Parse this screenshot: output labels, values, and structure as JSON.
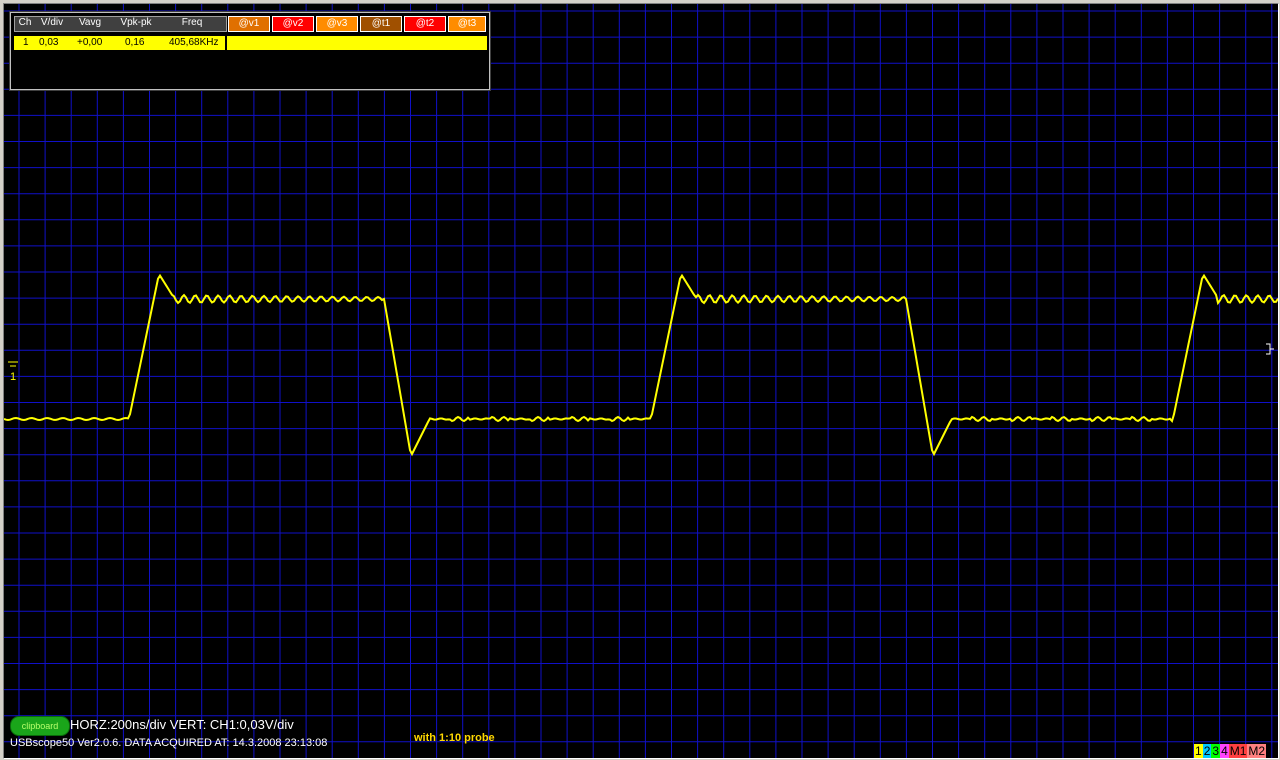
{
  "measure_table": {
    "headers": [
      "Ch",
      "V/div",
      "Vavg",
      "Vpk-pk",
      "Freq"
    ],
    "cursor_headers": [
      "@v1",
      "@v2",
      "@v3",
      "@t1",
      "@t2",
      "@t3"
    ],
    "row": {
      "ch": "1",
      "vdiv": "0,03",
      "vavg": "+0,00",
      "vpkpk": "0,16",
      "freq": "405,68KHz"
    }
  },
  "status": {
    "clipboard_label": "clipboard",
    "scale_line": "HORZ:200ns/div VERT: CH1:0,03V/div",
    "info_line": "USBscope50 Ver2.0.6.  DATA ACQUIRED AT: 14.3.2008 23:13:08",
    "annotation": "with 1:10 probe"
  },
  "channel_selector": [
    {
      "label": "1",
      "color": "#ffff00",
      "text_color": "#000000"
    },
    {
      "label": "2",
      "color": "#00c8ff",
      "text_color": "#000000"
    },
    {
      "label": "3",
      "color": "#00ff00",
      "text_color": "#000000"
    },
    {
      "label": "4",
      "color": "#ff44ff",
      "text_color": "#000000"
    },
    {
      "label": "M1",
      "color": "#ff4040",
      "text_color": "#000000"
    },
    {
      "label": "M2",
      "color": "#ff8080",
      "text_color": "#000000"
    }
  ],
  "colors": {
    "trace": "#ffff00",
    "grid": "#1010c8",
    "background": "#000000",
    "cursor_v": [
      "#e07000",
      "#ff0000",
      "#ff8c00"
    ],
    "cursor_t": [
      "#a05000",
      "#ff0000",
      "#ff8c00"
    ]
  },
  "ground_marker_label": "1"
}
